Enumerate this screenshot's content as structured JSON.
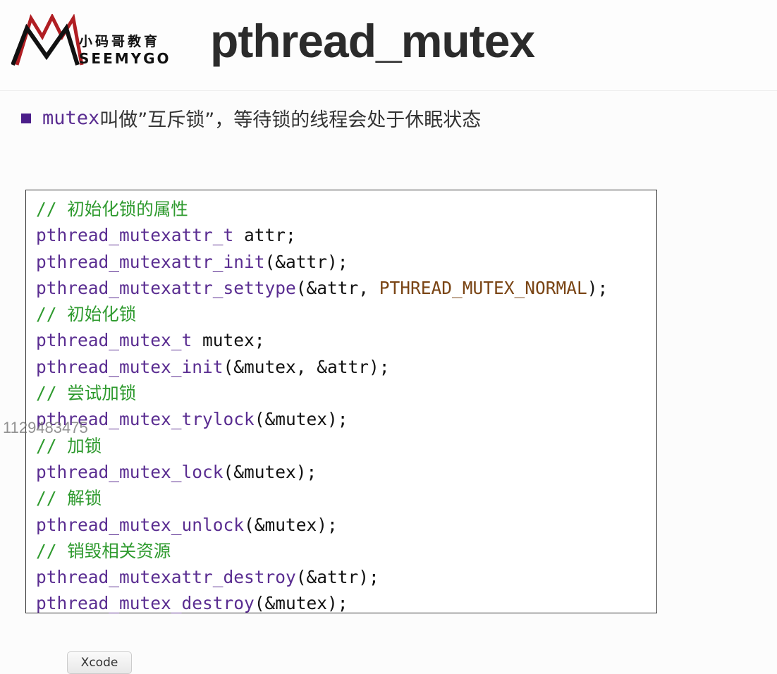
{
  "header": {
    "logo_cn": "小码哥教育",
    "logo_en": "SEEMYGO",
    "title": "pthread_mutex"
  },
  "bullet": {
    "keyword": "mutex",
    "text": "叫做”互斥锁”，等待锁的线程会处于休眠状态"
  },
  "code_lines": [
    [
      {
        "t": "cm",
        "v": "// 初始化锁的属性"
      }
    ],
    [
      {
        "t": "fn",
        "v": "pthread_mutexattr_t"
      },
      {
        "t": "plain",
        "v": " attr;"
      }
    ],
    [
      {
        "t": "fn",
        "v": "pthread_mutexattr_init"
      },
      {
        "t": "plain",
        "v": "(&attr);"
      }
    ],
    [
      {
        "t": "fn",
        "v": "pthread_mutexattr_settype"
      },
      {
        "t": "plain",
        "v": "(&attr, "
      },
      {
        "t": "const",
        "v": "PTHREAD_MUTEX_NORMAL"
      },
      {
        "t": "plain",
        "v": ");"
      }
    ],
    [
      {
        "t": "cm",
        "v": "// 初始化锁"
      }
    ],
    [
      {
        "t": "fn",
        "v": "pthread_mutex_t"
      },
      {
        "t": "plain",
        "v": " mutex;"
      }
    ],
    [
      {
        "t": "fn",
        "v": "pthread_mutex_init"
      },
      {
        "t": "plain",
        "v": "(&mutex, &attr);"
      }
    ],
    [
      {
        "t": "cm",
        "v": "// 尝试加锁"
      }
    ],
    [
      {
        "t": "fn",
        "v": "pthread_mutex_trylock"
      },
      {
        "t": "plain",
        "v": "(&mutex);"
      }
    ],
    [
      {
        "t": "cm",
        "v": "// 加锁"
      }
    ],
    [
      {
        "t": "fn",
        "v": "pthread_mutex_lock"
      },
      {
        "t": "plain",
        "v": "(&mutex);"
      }
    ],
    [
      {
        "t": "cm",
        "v": "// 解锁"
      }
    ],
    [
      {
        "t": "fn",
        "v": "pthread_mutex_unlock"
      },
      {
        "t": "plain",
        "v": "(&mutex);"
      }
    ],
    [
      {
        "t": "cm",
        "v": "// 销毁相关资源"
      }
    ],
    [
      {
        "t": "fn",
        "v": "pthread_mutexattr_destroy"
      },
      {
        "t": "plain",
        "v": "(&attr);"
      }
    ],
    [
      {
        "t": "fn",
        "v": "pthread_mutex_destroy"
      },
      {
        "t": "plain",
        "v": "(&mutex);"
      }
    ]
  ],
  "colors": {
    "function": "#5a2d91",
    "comment": "#2e9a2e",
    "constant": "#7a4515",
    "bullet": "#4b1e8a",
    "logo_red": "#b01e23"
  },
  "watermark": "1129483475",
  "xcode_button": "Xcode"
}
